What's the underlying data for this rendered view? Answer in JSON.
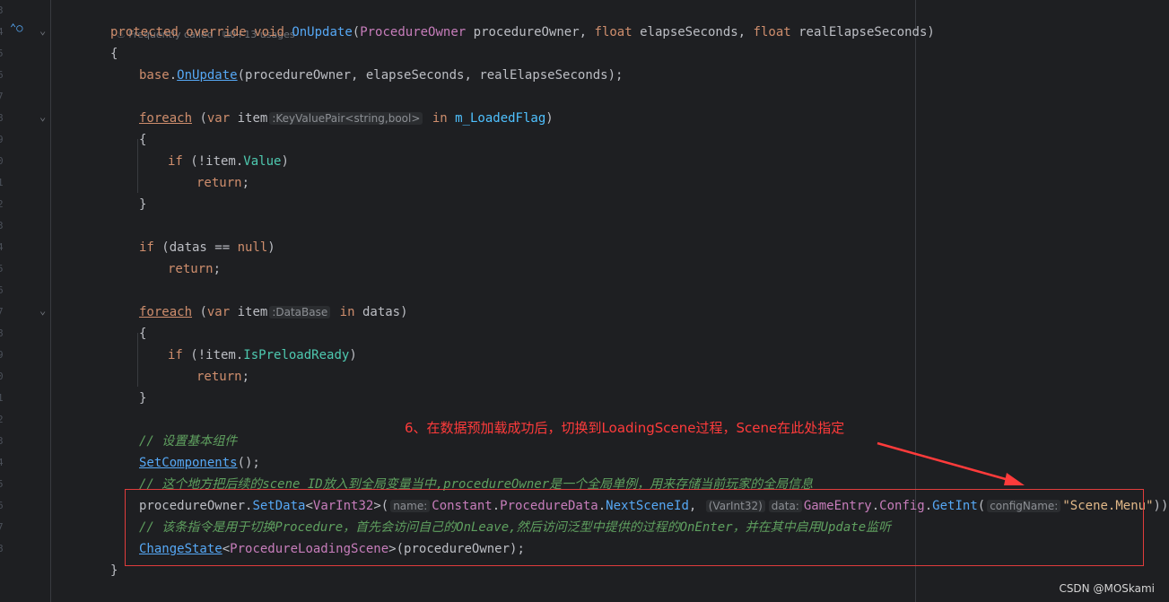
{
  "gutter": {
    "line_numbers": [
      "3",
      "4",
      "5",
      "6",
      "7",
      "8",
      "9",
      "0",
      "1",
      "2",
      "3",
      "4",
      "5",
      "6",
      "7",
      "8",
      "9",
      "0",
      "1",
      "2",
      "3",
      "4",
      "5",
      "6",
      "7",
      "8"
    ]
  },
  "hints": {
    "frequently_called": "Frequently called",
    "usages": "0+13 usages",
    "kvp_hint": ":KeyValuePair<string,bool>",
    "database_hint": ":DataBase",
    "name_hint": "name:",
    "varint_hint": "(VarInt32)",
    "data_hint": "data:",
    "configname_hint": "configName:"
  },
  "code": {
    "l1": {
      "kw1": "protected",
      "kw2": "override",
      "kw3": "void",
      "fn": "OnUpdate",
      "p1": "(",
      "t1": "ProcedureOwner",
      "r1": " procedureOwner, ",
      "kw4": "float",
      "r2": " elapseSeconds, ",
      "kw5": "float",
      "r3": " realElapseSeconds)"
    },
    "l2": "{",
    "l3": {
      "kw": "base",
      "dot": ".",
      "fn": "OnUpdate",
      "rest": "(procedureOwner, elapseSeconds, realElapseSeconds);"
    },
    "l5": {
      "kw": "foreach",
      "p": " (",
      "kw2": "var",
      "item": " item",
      "kw3": " in ",
      "mem": "m_LoadedFlag",
      "end": ")"
    },
    "l6": "{",
    "l7": {
      "kw": "if",
      "p": " (!item.",
      "prop": "Value",
      "end": ")"
    },
    "l8": {
      "kw": "return",
      "end": ";"
    },
    "l9": "}",
    "l11": {
      "kw": "if",
      "p": " (datas == ",
      "kw2": "null",
      "end": ")"
    },
    "l12": {
      "kw": "return",
      "end": ";"
    },
    "l14": {
      "kw": "foreach",
      "p": " (",
      "kw2": "var",
      "item": " item",
      "kw3": " in ",
      "rest": "datas)"
    },
    "l15": "{",
    "l16": {
      "kw": "if",
      "p": " (!item.",
      "prop": "IsPreloadReady",
      "end": ")"
    },
    "l17": {
      "kw": "return",
      "end": ";"
    },
    "l18": "}",
    "l20": "// 设置基本组件",
    "l21": {
      "fn": "SetComponents",
      "end": "();"
    },
    "l22": "// 这个地方把后续的scene ID放入到全局变量当中,procedureOwner是一个全局单例，用来存储当前玩家的全局信息",
    "l23": {
      "a": "procedureOwner.",
      "fn": "SetData",
      "b": "<",
      "t": "VarInt32",
      "c": ">(",
      "m1": "Constant",
      "d1": ".",
      "m2": "ProcedureData",
      "d2": ".",
      "m3": "NextSceneId",
      "e": ", ",
      "m4": "GameEntry",
      "d3": ".",
      "m5": "Config",
      "d4": ".",
      "fn2": "GetInt",
      "f": "(",
      "str": "\"Scene.Menu\"",
      "g": "));"
    },
    "l24": "// 该条指令是用于切换Procedure，首先会访问自己的OnLeave,然后访问泛型中提供的过程的OnEnter，并在其中启用Update监听",
    "l25": {
      "fn": "ChangeState",
      "a": "<",
      "t": "ProcedureLoadingScene",
      "b": ">(procedureOwner);"
    },
    "l26": "}"
  },
  "annotation": "6、在数据预加载成功后，切换到LoadingScene过程，Scene在此处指定",
  "watermark": "CSDN @MOSkami",
  "colors": {
    "annotation": "#ff3b3b",
    "keyword": "#cf8e6d",
    "function": "#56a8f5",
    "comment": "#5fa05f",
    "string": "#e1b888"
  }
}
